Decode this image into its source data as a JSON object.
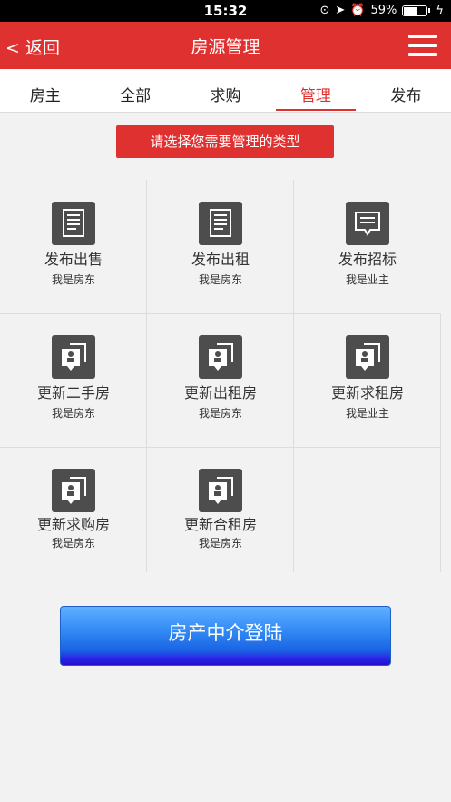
{
  "status_bar": {
    "time": "15:32",
    "battery_percent": "59%",
    "battery_level": 0.59
  },
  "nav": {
    "back_label": "< 返回",
    "title": "房源管理"
  },
  "tabs": [
    {
      "label": "房主",
      "active": false
    },
    {
      "label": "全部",
      "active": false
    },
    {
      "label": "求购",
      "active": false
    },
    {
      "label": "管理",
      "active": true
    },
    {
      "label": "发布",
      "active": false
    }
  ],
  "type_banner": "请选择您需要管理的类型",
  "grid_items": [
    {
      "title": "发布出售",
      "subtitle": "我是房东",
      "icon": "document-icon"
    },
    {
      "title": "发布出租",
      "subtitle": "我是房东",
      "icon": "document-icon"
    },
    {
      "title": "发布招标",
      "subtitle": "我是业主",
      "icon": "message-icon"
    },
    {
      "title": "更新二手房",
      "subtitle": "我是房东",
      "icon": "contact-card-icon"
    },
    {
      "title": "更新出租房",
      "subtitle": "我是房东",
      "icon": "contact-card-icon"
    },
    {
      "title": "更新求租房",
      "subtitle": "我是业主",
      "icon": "contact-card-icon"
    },
    {
      "title": "更新求购房",
      "subtitle": "我是房东",
      "icon": "contact-card-icon"
    },
    {
      "title": "更新合租房",
      "subtitle": "我是房东",
      "icon": "contact-card-icon"
    }
  ],
  "login_button": "房产中介登陆",
  "colors": {
    "brand_red": "#e03131",
    "icon_bg": "#4d4d4d",
    "button_blue": "#2f86f2"
  }
}
